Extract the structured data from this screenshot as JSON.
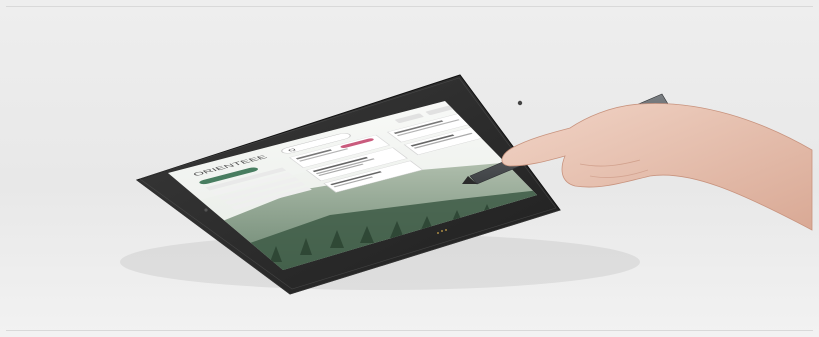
{
  "scene": {
    "subject": "tablet-with-stylus",
    "colors": {
      "background": "#ececec",
      "tablet_body": "#2a2a2a",
      "screen_bg": "#f6f7f5",
      "brand_green": "#2f6b4a",
      "accent_pink": "#c2456b",
      "stylus": "#5a5d60",
      "skin": "#e8c5b5"
    }
  },
  "screen": {
    "logo_text": "ORIENTEEE",
    "search_placeholder": "Q"
  }
}
